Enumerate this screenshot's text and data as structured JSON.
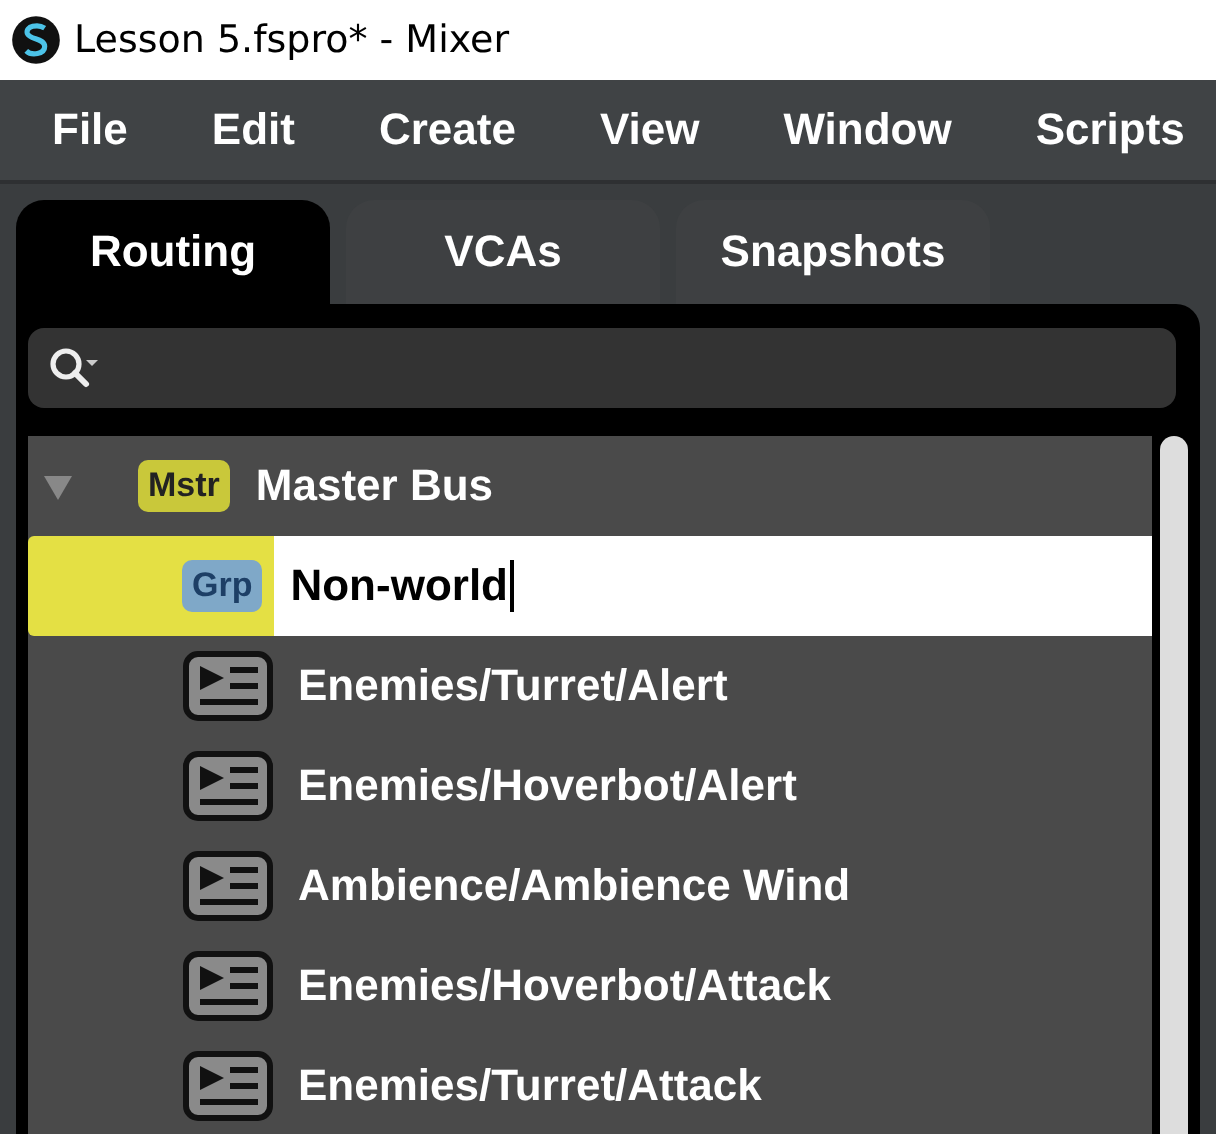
{
  "window": {
    "title": "Lesson 5.fspro* - Mixer"
  },
  "menu": [
    "File",
    "Edit",
    "Create",
    "View",
    "Window",
    "Scripts"
  ],
  "tabs": [
    {
      "label": "Routing",
      "selected": true
    },
    {
      "label": "VCAs",
      "selected": false
    },
    {
      "label": "Snapshots",
      "selected": false
    }
  ],
  "tree": [
    {
      "badge": "Mstr",
      "label": "Master Bus",
      "expanded": true,
      "selected": false,
      "children": [
        {
          "kind": "group",
          "badge": "Grp",
          "label": "Non-world",
          "editing": true,
          "selected": true
        },
        {
          "kind": "event",
          "label": "Enemies/Turret/Alert",
          "selected": false
        },
        {
          "kind": "event",
          "label": "Enemies/Hoverbot/Alert",
          "selected": false
        },
        {
          "kind": "event",
          "label": "Ambience/Ambience Wind",
          "selected": false
        },
        {
          "kind": "event",
          "label": "Enemies/Hoverbot/Attack",
          "selected": false
        },
        {
          "kind": "event",
          "label": "Enemies/Turret/Attack",
          "selected": false
        }
      ]
    }
  ]
}
